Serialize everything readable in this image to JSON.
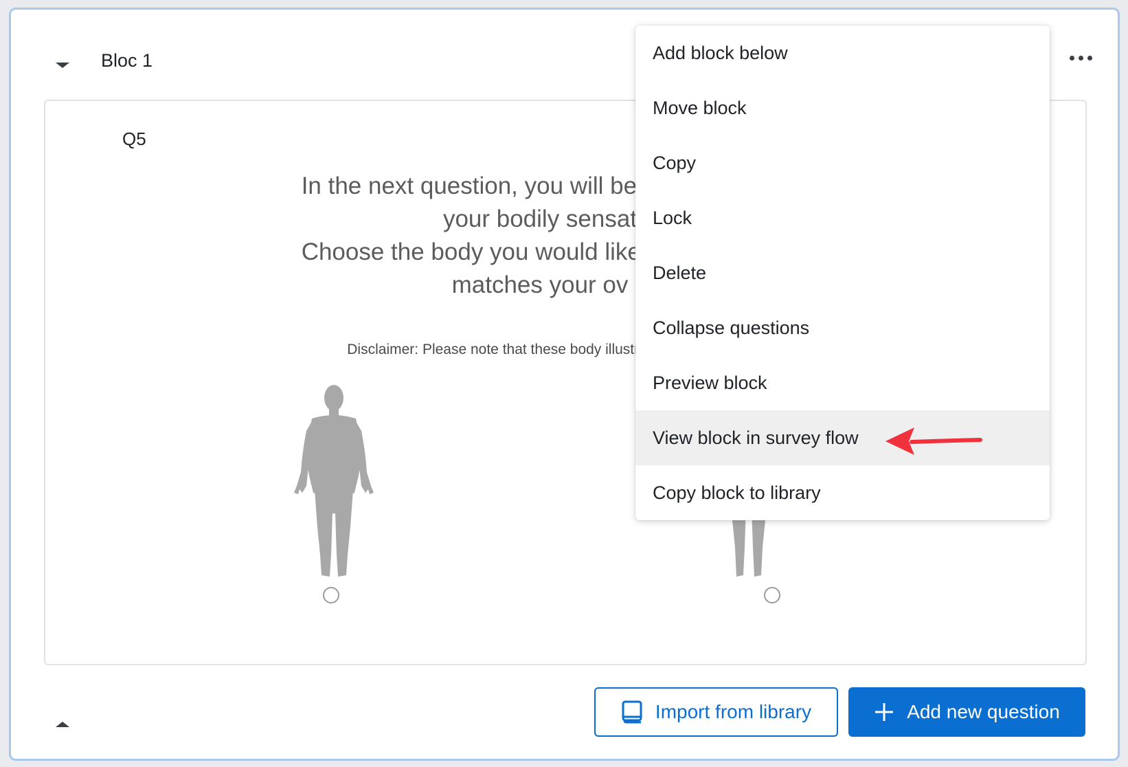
{
  "block": {
    "title": "Bloc 1"
  },
  "question": {
    "number": "Q5",
    "text_lines": [
      "In the next question, you will be asked to indi",
      "your bodily sensat",
      "Choose the body you would like to have in th",
      "matches your ov"
    ],
    "disclaimer": "Disclaimer: Please note that these body illustrations do not c"
  },
  "menu": {
    "items": [
      {
        "label": "Add block below"
      },
      {
        "label": "Move block"
      },
      {
        "label": "Copy"
      },
      {
        "label": "Lock"
      },
      {
        "label": "Delete"
      },
      {
        "label": "Collapse questions"
      },
      {
        "label": "Preview block"
      },
      {
        "label": "View block in survey flow"
      },
      {
        "label": "Copy block to library"
      }
    ],
    "highlighted": "View block in survey flow"
  },
  "buttons": {
    "import_label": "Import from library",
    "add_label": "Add new question"
  },
  "colors": {
    "accent": "#0b6ed1",
    "card_border": "#a9c8ec",
    "annotation_arrow": "#f0323c",
    "menu_highlight": "#efefef"
  },
  "icons": {
    "collapse": "chevron-down-icon",
    "more": "more-dots-icon",
    "import": "book-icon",
    "add": "plus-icon",
    "expand": "chevron-up-icon"
  }
}
